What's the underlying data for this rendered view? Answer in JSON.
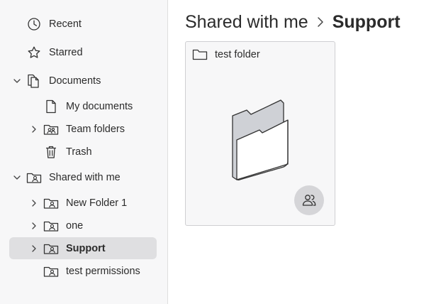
{
  "sidebar": {
    "items": [
      {
        "label": "Recent",
        "icon": "clock-icon",
        "expandable": false,
        "selected": false
      },
      {
        "label": "Starred",
        "icon": "star-icon",
        "expandable": false,
        "selected": false
      },
      {
        "label": "Documents",
        "icon": "documents-icon",
        "expandable": true,
        "expanded": true,
        "selected": false
      },
      {
        "label": "My documents",
        "icon": "document-icon",
        "expandable": false,
        "selected": false
      },
      {
        "label": "Team folders",
        "icon": "team-folder-icon",
        "expandable": true,
        "expanded": false,
        "selected": false
      },
      {
        "label": "Trash",
        "icon": "trash-icon",
        "expandable": false,
        "selected": false
      },
      {
        "label": "Shared with me",
        "icon": "shared-folder-icon",
        "expandable": true,
        "expanded": true,
        "selected": false
      },
      {
        "label": "New Folder 1",
        "icon": "shared-folder-icon",
        "expandable": true,
        "expanded": false,
        "selected": false
      },
      {
        "label": "one",
        "icon": "shared-folder-icon",
        "expandable": true,
        "expanded": false,
        "selected": false
      },
      {
        "label": "Support",
        "icon": "shared-folder-icon",
        "expandable": true,
        "expanded": false,
        "selected": true
      },
      {
        "label": "test permissions",
        "icon": "shared-folder-icon",
        "expandable": false,
        "selected": false
      }
    ]
  },
  "breadcrumb": {
    "parent": "Shared with me",
    "current": "Support"
  },
  "card": {
    "title": "test folder",
    "icon": "folder-outline-icon",
    "badge_icon": "shared-users-icon"
  },
  "colors": {
    "sidebar_bg": "#f7f7f8",
    "selected_bg": "#dfdfe1",
    "badge_bg": "#d5d5d8",
    "text": "#2b2b2b"
  }
}
